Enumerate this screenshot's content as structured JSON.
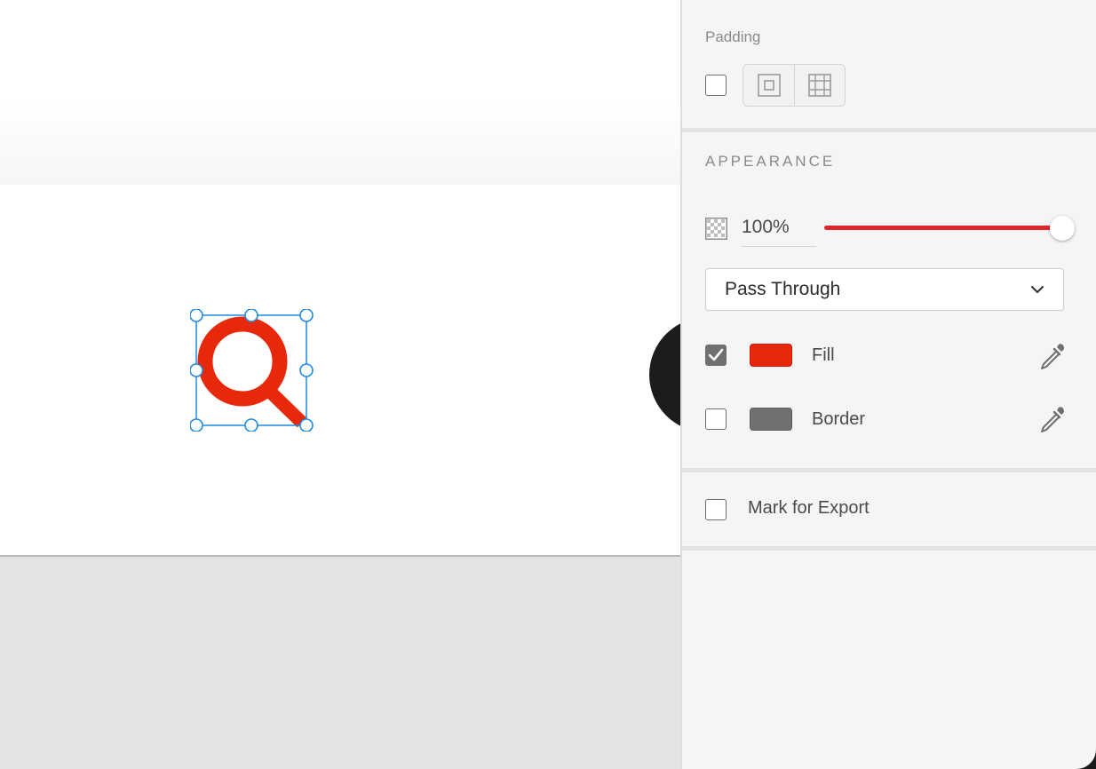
{
  "canvas": {
    "selected_layer_color": "#e8280a",
    "selection_color": "#1f8ae0",
    "icon": "magnifier-icon"
  },
  "inspector": {
    "padding": {
      "label": "Padding",
      "enabled": false,
      "uniform_icon": "padding-uniform-icon",
      "independent_icon": "padding-independent-icon"
    },
    "appearance": {
      "section_title": "APPEARANCE",
      "opacity": {
        "value_text": "100%",
        "level_percent": 100,
        "slider_color": "#e0242e",
        "icon": "checkerboard-opacity-icon"
      },
      "blend_mode": {
        "selected": "Pass Through"
      },
      "fill": {
        "label": "Fill",
        "enabled": true,
        "color": "#e8280a",
        "icon": "eyedropper-icon"
      },
      "border": {
        "label": "Border",
        "enabled": false,
        "color": "#707070",
        "icon": "eyedropper-icon"
      }
    },
    "export": {
      "label": "Mark for Export",
      "enabled": false
    }
  }
}
